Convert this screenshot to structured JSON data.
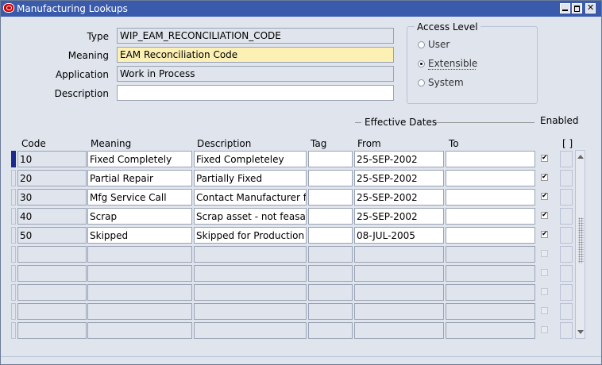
{
  "window": {
    "title": "Manufacturing Lookups"
  },
  "header": {
    "type_label": "Type",
    "type_value": "WIP_EAM_RECONCILIATION_CODE",
    "meaning_label": "Meaning",
    "meaning_value": "EAM Reconciliation Code",
    "application_label": "Application",
    "application_value": "Work in Process",
    "description_label": "Description",
    "description_value": ""
  },
  "access_level": {
    "title": "Access Level",
    "options": [
      "User",
      "Extensible",
      "System"
    ],
    "selected": "Extensible"
  },
  "table": {
    "effective_dates_label": "Effective Dates",
    "enabled_label": "Enabled",
    "dff_label": "[ ]",
    "columns": {
      "code": "Code",
      "meaning": "Meaning",
      "description": "Description",
      "tag": "Tag",
      "from": "From",
      "to": "To"
    },
    "rows": [
      {
        "code": "10",
        "meaning": "Fixed Completely",
        "description": "Fixed Completeley",
        "tag": "",
        "from": "25-SEP-2002",
        "to": "",
        "enabled": true
      },
      {
        "code": "20",
        "meaning": "Partial Repair",
        "description": "Partially Fixed",
        "tag": "",
        "from": "25-SEP-2002",
        "to": "",
        "enabled": true
      },
      {
        "code": "30",
        "meaning": "Mfg Service Call",
        "description": "Contact Manufacturer fo",
        "tag": "",
        "from": "25-SEP-2002",
        "to": "",
        "enabled": true
      },
      {
        "code": "40",
        "meaning": "Scrap",
        "description": "Scrap asset - not feasab",
        "tag": "",
        "from": "25-SEP-2002",
        "to": "",
        "enabled": true
      },
      {
        "code": "50",
        "meaning": "Skipped",
        "description": "Skipped for Production F",
        "tag": "",
        "from": "08-JUL-2005",
        "to": "",
        "enabled": true
      },
      {
        "code": "",
        "meaning": "",
        "description": "",
        "tag": "",
        "from": "",
        "to": "",
        "enabled": false
      },
      {
        "code": "",
        "meaning": "",
        "description": "",
        "tag": "",
        "from": "",
        "to": "",
        "enabled": false
      },
      {
        "code": "",
        "meaning": "",
        "description": "",
        "tag": "",
        "from": "",
        "to": "",
        "enabled": false
      },
      {
        "code": "",
        "meaning": "",
        "description": "",
        "tag": "",
        "from": "",
        "to": "",
        "enabled": false
      },
      {
        "code": "",
        "meaning": "",
        "description": "",
        "tag": "",
        "from": "",
        "to": "",
        "enabled": false
      }
    ]
  },
  "colors": {
    "titlebar": "#3a5bab",
    "window_bg": "#dfe4ed",
    "required_field": "#fcf0b4",
    "current_row_marker": "#1a2b8c"
  }
}
